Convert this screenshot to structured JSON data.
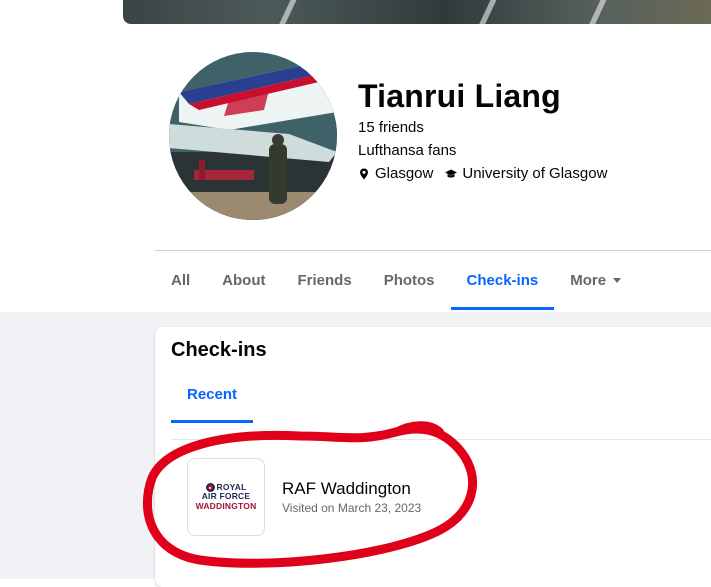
{
  "profile": {
    "name": "Tianrui Liang",
    "friends": "15 friends",
    "subtitle": "Lufthansa fans",
    "location": "Glasgow",
    "education": "University of Glasgow"
  },
  "tabs": [
    {
      "label": "All",
      "active": false
    },
    {
      "label": "About",
      "active": false
    },
    {
      "label": "Friends",
      "active": false
    },
    {
      "label": "Photos",
      "active": false
    },
    {
      "label": "Check-ins",
      "active": true
    },
    {
      "label": "More",
      "active": false
    }
  ],
  "checkins": {
    "title": "Check-ins",
    "subtab": "Recent",
    "items": [
      {
        "place": "RAF Waddington",
        "visited": "Visited on March 23, 2023",
        "logo": {
          "line1": "ROYAL",
          "line2": "AIR FORCE",
          "line3": "WADDINGTON"
        }
      }
    ]
  },
  "colors": {
    "accent": "#0866ff",
    "annotation": "#e0001a",
    "background": "#f0f2f5"
  }
}
